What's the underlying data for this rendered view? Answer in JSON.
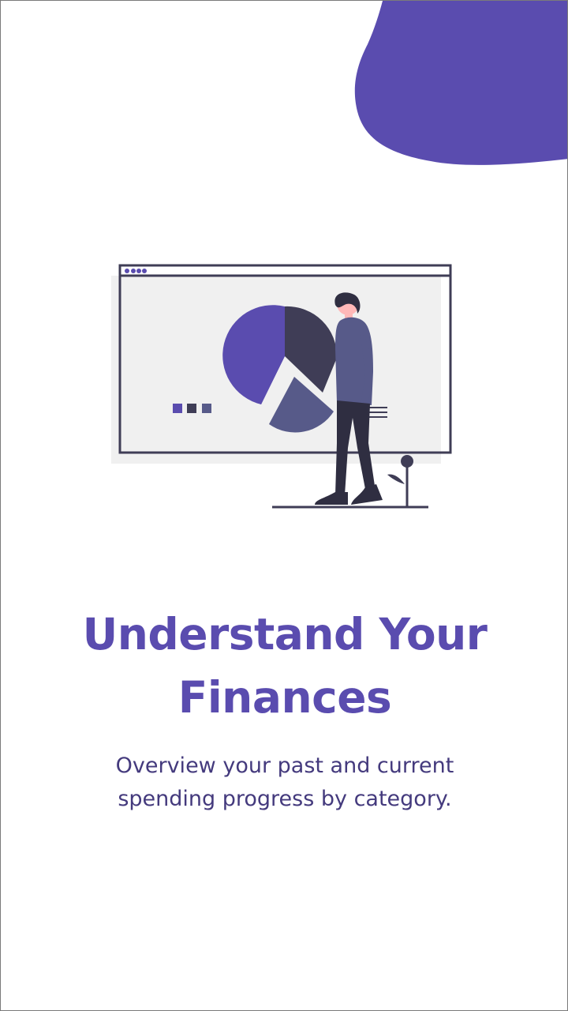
{
  "onboarding": {
    "title": "Understand Your Finances",
    "subtitle": "Overview your past and current spending progress by category."
  },
  "illustration": {
    "icon": "finance-presentation-illustration",
    "colors": {
      "primary": "#5a4caf",
      "dark": "#3f3d56",
      "muted": "#575a89",
      "panel": "#f0f0f0"
    }
  }
}
